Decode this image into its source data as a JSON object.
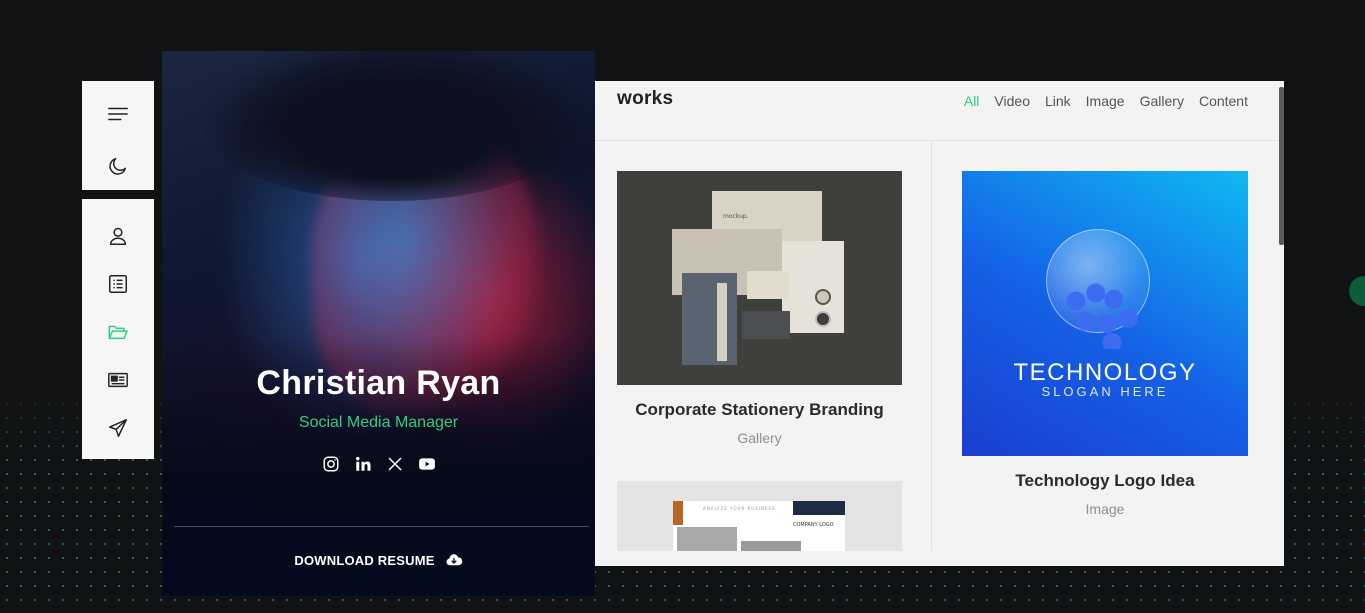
{
  "nav": {
    "top": [
      {
        "name": "menu-icon"
      },
      {
        "name": "moon-icon"
      }
    ],
    "main": [
      {
        "name": "user-icon",
        "active": false
      },
      {
        "name": "list-icon",
        "active": false
      },
      {
        "name": "folder-open-icon",
        "active": true
      },
      {
        "name": "newspaper-icon",
        "active": false
      },
      {
        "name": "paper-plane-icon",
        "active": false
      }
    ]
  },
  "profile": {
    "name": "Christian Ryan",
    "role": "Social Media Manager",
    "socials": [
      "instagram-icon",
      "linkedin-icon",
      "x-icon",
      "youtube-icon"
    ],
    "download_label": "DOWNLOAD RESUME"
  },
  "works": {
    "title": "works",
    "filters": [
      {
        "label": "All",
        "active": true
      },
      {
        "label": "Video",
        "active": false
      },
      {
        "label": "Link",
        "active": false
      },
      {
        "label": "Image",
        "active": false
      },
      {
        "label": "Gallery",
        "active": false
      },
      {
        "label": "Content",
        "active": false
      }
    ],
    "items": [
      {
        "title": "Corporate Stationery Branding",
        "category": "Gallery",
        "thumb_text": "mockup."
      },
      {
        "title": "Technology Logo Idea",
        "category": "Image",
        "thumb_title": "TECHNOLOGY",
        "thumb_slogan": "SLOGAN HERE"
      },
      {
        "title": "",
        "category": "",
        "thumb_label": "COMPANY LOGO",
        "thumb_header": "ANALYZE YOUR BUSINESS"
      }
    ]
  },
  "colors": {
    "accent": "#2ecf83",
    "background": "#111213",
    "panel": "#f3f3f3"
  }
}
